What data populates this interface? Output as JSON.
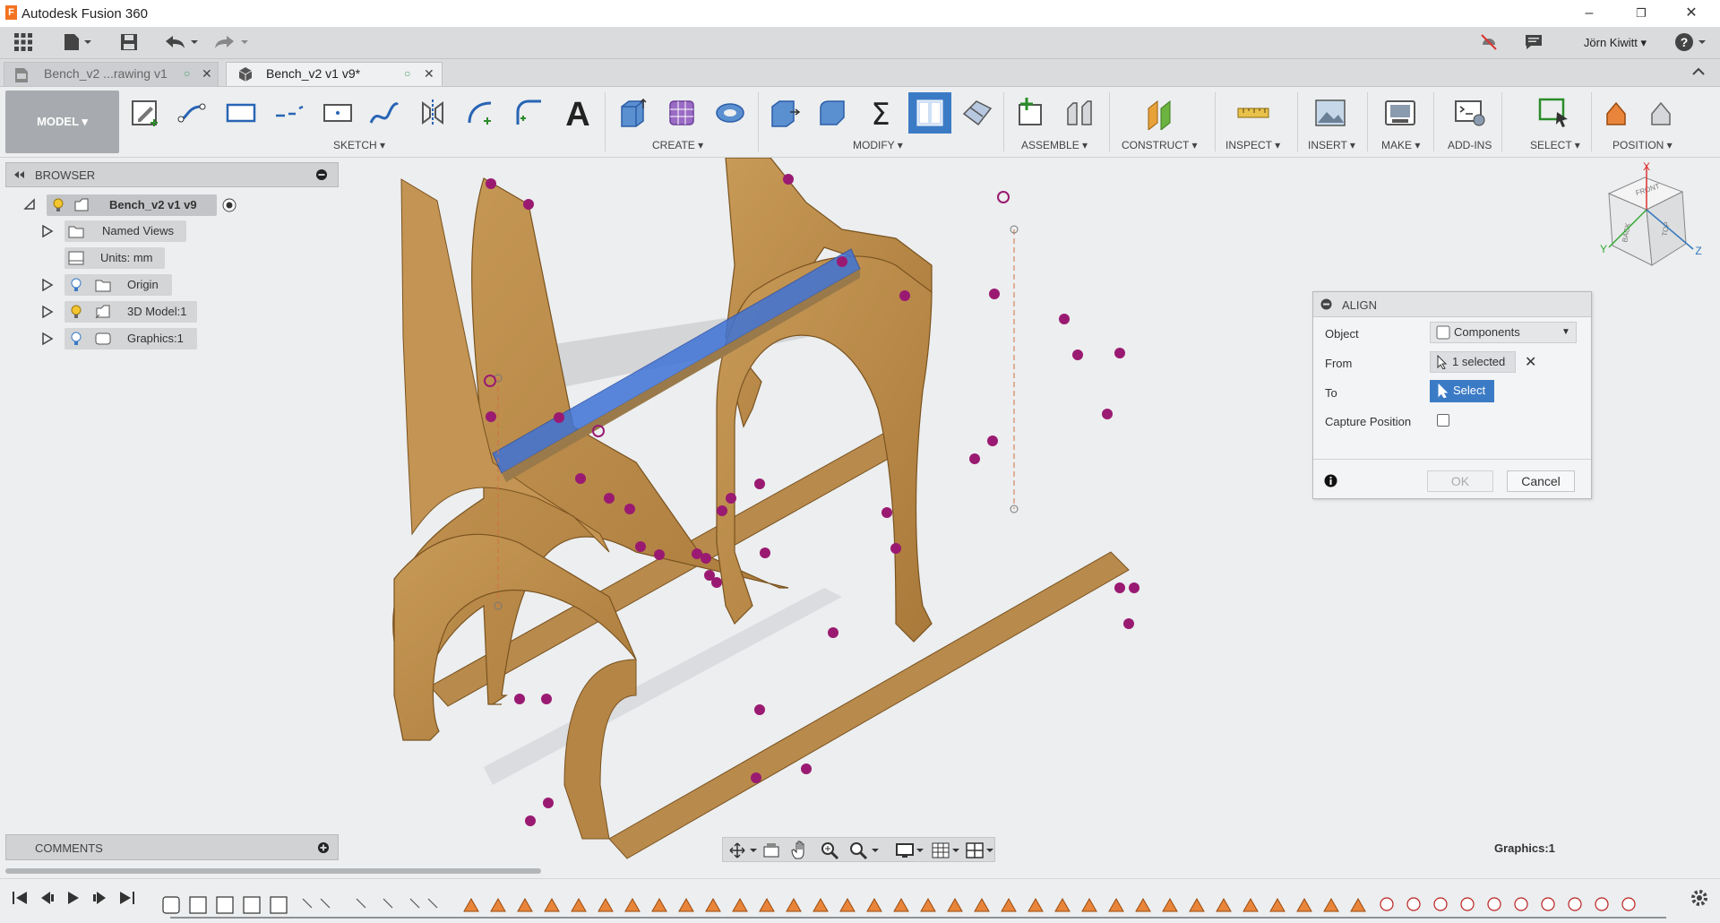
{
  "window": {
    "title": "Autodesk Fusion 360",
    "logo_letter": "F",
    "minimize": "–",
    "restore": "❐",
    "close": "✕"
  },
  "quick_access": {
    "user": "Jörn Kiwitt ▾",
    "help": "?"
  },
  "tabs": [
    {
      "label": "Bench_v2 ...rawing v1"
    },
    {
      "label": "Bench_v2 v1 v9*"
    }
  ],
  "toolbar": {
    "model_label": "MODEL ▾",
    "groups": [
      {
        "label": "SKETCH ▾"
      },
      {
        "label": "CREATE ▾"
      },
      {
        "label": "MODIFY ▾"
      },
      {
        "label": "ASSEMBLE ▾"
      },
      {
        "label": "CONSTRUCT ▾"
      },
      {
        "label": "INSPECT ▾"
      },
      {
        "label": "INSERT ▾"
      },
      {
        "label": "MAKE ▾"
      },
      {
        "label": "ADD-INS"
      },
      {
        "label": "SELECT ▾"
      },
      {
        "label": "POSITION ▾"
      }
    ]
  },
  "browser": {
    "title": "BROWSER",
    "root": "Bench_v2 v1 v9",
    "items": [
      {
        "label": "Named Views"
      },
      {
        "label": "Units: mm"
      },
      {
        "label": "Origin"
      },
      {
        "label": "3D Model:1"
      },
      {
        "label": "Graphics:1"
      }
    ]
  },
  "viewcube": {
    "faces": [
      "FRONT",
      "BACK",
      "TOP"
    ],
    "axes": [
      "X",
      "Y",
      "Z"
    ]
  },
  "align_dialog": {
    "title": "ALIGN",
    "object_label": "Object",
    "object_value": "Components",
    "from_label": "From",
    "from_value": "1 selected",
    "to_label": "To",
    "to_value": "Select",
    "capture_label": "Capture Position",
    "capture_checked": false,
    "ok": "OK",
    "cancel": "Cancel"
  },
  "comments": {
    "title": "COMMENTS"
  },
  "status": {
    "selection": "Graphics:1"
  },
  "colors": {
    "accent": "#3b7bc6",
    "wood": "#b88a4c",
    "selection_blue": "#3f73d6",
    "constraint_magenta": "#9a1a72",
    "toolbar_bg": "#eceeef"
  }
}
